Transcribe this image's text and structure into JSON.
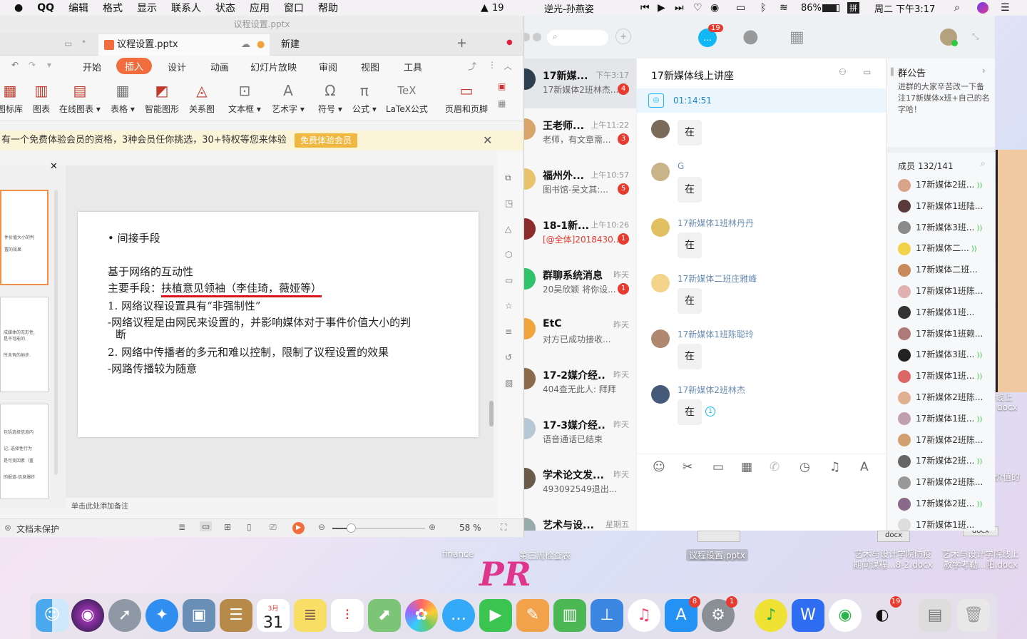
{
  "menubar": {
    "apple": "",
    "app": "QQ",
    "items": [
      "编辑",
      "格式",
      "显示",
      "联系人",
      "状态",
      "应用",
      "窗口",
      "帮助"
    ],
    "notif_count": "19",
    "song": "逆光-孙燕姿",
    "battery": "86%",
    "input_icon": "拼",
    "datetime": "周二 下午3:17"
  },
  "desktop": {
    "labels": [
      "finance",
      "第三周检查表",
      "议程设置.pptx",
      "艺术与设计学院防疫期间课程...8-2.docx",
      "艺术与设计学院线上教学考勤...阳.docx",
      "线上",
      "docx",
      "价值的",
      "docx",
      "docx"
    ]
  },
  "wps": {
    "title": "议程设置.pptx",
    "tabs": [
      {
        "label": "议程设置.pptx"
      },
      {
        "label": "新建"
      }
    ],
    "menu": [
      "开始",
      "插入",
      "设计",
      "动画",
      "幻灯片放映",
      "审阅",
      "视图",
      "工具"
    ],
    "active_menu": "插入",
    "ribbon": [
      "图标库",
      "图表",
      "在线图表",
      "表格",
      "智能图形",
      "关系图",
      "文本框",
      "艺术字",
      "符号",
      "公式",
      "LaTeX公式",
      "页眉和页脚"
    ],
    "banner": "有一个免费体验会员的资格，3种会员任你挑选，30+特权等您来体验",
    "banner_button": "免费体验会员",
    "slide": {
      "bullet": "• 间接手段",
      "line1": "基于网络的互动性",
      "line2_prefix": "主要手段：",
      "line2_under": "扶植意见领袖（李佳琦，薇娅等）",
      "line3": "1. 网络议程设置具有“非强制性”",
      "line4": "-网络议程是由网民来设置的，并影响媒体对于事件价值大小的判",
      "line4b": "断",
      "line5": "2. 网络中传播者的多元和难以控制，限制了议程设置的效果",
      "line6": "-网路传播较为随意"
    },
    "thumb_texts": [
      "件价值大小的判",
      "置的效果",
      "成媒体的无形性,",
      "是不可能的.",
      "所未有的地步.",
      "包括选择信息内",
      "记, 选择性行为",
      "是可变因素（重",
      "的报道-信息爆炸"
    ],
    "notes_placeholder": "单击此处添加备注",
    "status": {
      "protect": "文档未保护",
      "zoom": "58 %",
      "zoom_fraction": 0.2
    }
  },
  "qq": {
    "unread": "19",
    "conversations": [
      {
        "name": "17新媒...",
        "time": "下午3:17",
        "preview": "17新媒体2班林杰...",
        "badge": "4"
      },
      {
        "name": "王老师...",
        "time": "上午11:22",
        "preview": "老师，有文章需...",
        "badge": "3"
      },
      {
        "name": "福州外...",
        "time": "上午10:57",
        "preview": "图书馆-吴文其:...",
        "badge": "5"
      },
      {
        "name": "18-1新...",
        "time": "上午10:26",
        "preview": "[@全体]2018430...",
        "badge": "1"
      },
      {
        "name": "群聊系统消息",
        "time": "昨天",
        "preview": "20吴欣颖 将你设...",
        "badge": "1"
      },
      {
        "name": "EtC",
        "time": "昨天",
        "preview": "对方已成功接收...",
        "badge": ""
      },
      {
        "name": "17-2媒介经...",
        "time": "昨天",
        "preview": "404查无此人: 拜拜",
        "badge": ""
      },
      {
        "name": "17-3媒介经...",
        "time": "昨天",
        "preview": "语音通话已结束",
        "badge": ""
      },
      {
        "name": "学术论文发...",
        "time": "昨天",
        "preview": "493092549退出...",
        "badge": ""
      },
      {
        "name": "艺术与设...",
        "time": "星期五",
        "preview": "",
        "badge": ""
      }
    ],
    "chat": {
      "title": "17新媒体线上讲座",
      "call_time": "01:14:51",
      "messages": [
        {
          "name": "",
          "text": "在"
        },
        {
          "name": "G",
          "text": "在"
        },
        {
          "name": "17新媒体1班林丹丹",
          "text": "在"
        },
        {
          "name": "17新媒体二班庄雅峰",
          "text": "在"
        },
        {
          "name": "17新媒体1班陈聪玲",
          "text": "在"
        },
        {
          "name": "17新媒体2班林杰",
          "text": "在"
        }
      ]
    },
    "side": {
      "notice_title": "群公告",
      "notice_text": "进群的大家辛苦改一下备注17新媒体x班+自己的名字哈！",
      "members_label": "成员 132/141",
      "members": [
        "17新媒体2班...",
        "17新媒体1班陆...",
        "17新媒体3班...",
        "17新媒体二...",
        "17新媒体二班...",
        "17新媒体1班陈...",
        "17新媒体1班...",
        "17新媒体1班赖...",
        "17新媒体3班...",
        "17新媒体1班...",
        "17新媒体2班陈...",
        "17新媒体1班...",
        "17新媒体2班陈...",
        "17新媒体2班...",
        "17新媒体2班陈...",
        "17新媒体2班...",
        "17新媒体1班..."
      ]
    }
  },
  "dock": {
    "calendar_month": "3月",
    "calendar_day": "31",
    "badges": {
      "appstore": "8",
      "settings": "1",
      "qq": "19"
    }
  },
  "colors": {
    "accent_red": "#e63b2e",
    "wps_orange": "#f26d3d",
    "qq_blue": "#12b7f5",
    "underline_red": "#d9141c"
  }
}
